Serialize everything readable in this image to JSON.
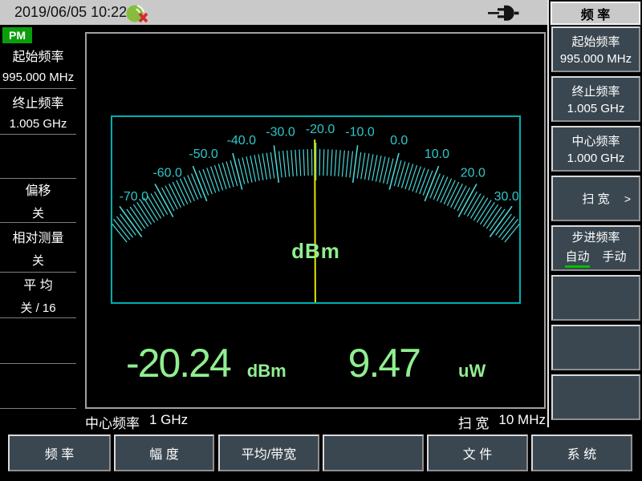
{
  "topbar": {
    "datetime": "2019/06/05 10:22"
  },
  "icons": {
    "gps": "gps-no-signal-icon",
    "power": "ac-power-plug-icon"
  },
  "left_panel": {
    "badge": "PM",
    "rows": [
      {
        "label": "起始频率",
        "value": "995.000 MHz"
      },
      {
        "label": "终止频率",
        "value": "1.005 GHz"
      },
      {
        "label": "",
        "value": ""
      },
      {
        "label": "偏移",
        "value": "关"
      },
      {
        "label": "相对测量",
        "value": "关"
      },
      {
        "label": "平 均",
        "value": "关 / 16"
      },
      {
        "label": "",
        "value": ""
      },
      {
        "label": "",
        "value": ""
      }
    ]
  },
  "meter": {
    "unit": "dBm",
    "min": -70,
    "max": 30,
    "major_step": 10,
    "minor_step": 1,
    "overrun": 4,
    "needle_value": -20.24,
    "tick_color": "#49D6D6",
    "label_color": "#2DC8C8",
    "needle_color": "#E6E600",
    "frame_color": "#00AFAF"
  },
  "readout": {
    "dbm_value": "-20.24",
    "dbm_unit": "dBm",
    "watt_value": "9.47",
    "watt_unit": "uW",
    "color": "#90EE90"
  },
  "status": {
    "center_label": "中心频率",
    "center_value": "1 GHz",
    "span_label": "扫 宽",
    "span_value": "10 MHz"
  },
  "sidebar": {
    "title": "频 率",
    "buttons": [
      {
        "line1": "起始频率",
        "line2": "995.000 MHz"
      },
      {
        "line1": "终止频率",
        "line2": "1.005 GHz"
      },
      {
        "line1": "中心频率",
        "line2": "1.000 GHz"
      },
      {
        "line1": "扫 宽",
        "arrow": ">"
      },
      {
        "line1": "步进频率",
        "options": [
          "自动",
          "手动"
        ],
        "selected": "自动"
      },
      {
        "line1": ""
      },
      {
        "line1": ""
      },
      {
        "line1": ""
      }
    ]
  },
  "bottom_menu": {
    "buttons": [
      "频 率",
      "幅 度",
      "平均/带宽",
      "",
      "文 件",
      "系 统"
    ]
  }
}
